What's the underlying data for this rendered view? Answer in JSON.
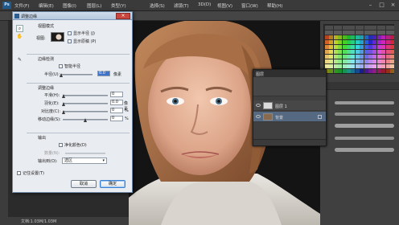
{
  "app": {
    "logo_text": "Ps",
    "menu": [
      "文件(F)",
      "编辑(E)",
      "图像(I)",
      "图层(L)",
      "类型(Y)",
      "选择(S)",
      "滤镜(T)",
      "3D(D)",
      "视图(V)",
      "窗口(W)",
      "帮助(H)"
    ],
    "window_controls": [
      "–",
      "□",
      "×"
    ],
    "status_text": "文档:1.03M/1.03M"
  },
  "dialog": {
    "title": "调整边缘",
    "close_label": "×",
    "tools": [
      "⌕",
      "✋",
      "✎"
    ],
    "view_mode": {
      "group_label": "视图模式",
      "view_label": "视图:",
      "show_radius_label": "显示半径 (J)",
      "show_original_label": "显示原稿 (P)"
    },
    "edge_detection": {
      "group_label": "边缘检测",
      "smart_radius_label": "智能半径",
      "radius_label": "半径(U):",
      "radius_value": "0.0",
      "radius_unit": "像素"
    },
    "adjust_edge": {
      "group_label": "调整边缘",
      "rows": [
        {
          "label": "平滑(H):",
          "value": "0",
          "unit": ""
        },
        {
          "label": "羽化(E):",
          "value": "0.0",
          "unit": "像素"
        },
        {
          "label": "对比度(C):",
          "value": "0",
          "unit": "%"
        },
        {
          "label": "移动边缘(S):",
          "value": "0",
          "unit": "%"
        }
      ]
    },
    "output": {
      "group_label": "输出",
      "decontaminate_label": "净化颜色(D)",
      "amount_label": "数量(N):",
      "output_to_label": "输出到(O):",
      "output_to_value": "选区"
    },
    "remember_label": "记住设置(T)",
    "cancel_label": "取消",
    "ok_label": "确定"
  },
  "layers_panel": {
    "title": "图层",
    "layers": [
      {
        "name": "图层 1",
        "selected": false
      },
      {
        "name": "背景",
        "selected": true
      }
    ]
  },
  "colors": {
    "accent": "#3d74c9",
    "selected_layer": "#556a82",
    "dialog_bg": "#e9ecf1"
  }
}
